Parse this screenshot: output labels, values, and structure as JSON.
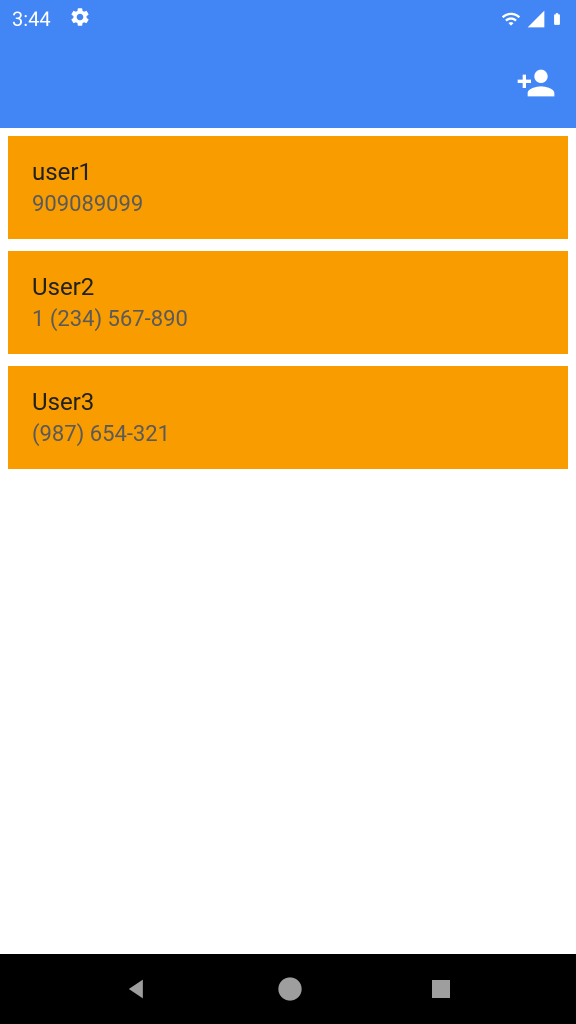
{
  "statusBar": {
    "time": "3:44"
  },
  "contacts": [
    {
      "name": "user1",
      "phone": "909089099"
    },
    {
      "name": "User2",
      "phone": "1 (234) 567-890"
    },
    {
      "name": "User3",
      "phone": "(987) 654-321"
    }
  ]
}
